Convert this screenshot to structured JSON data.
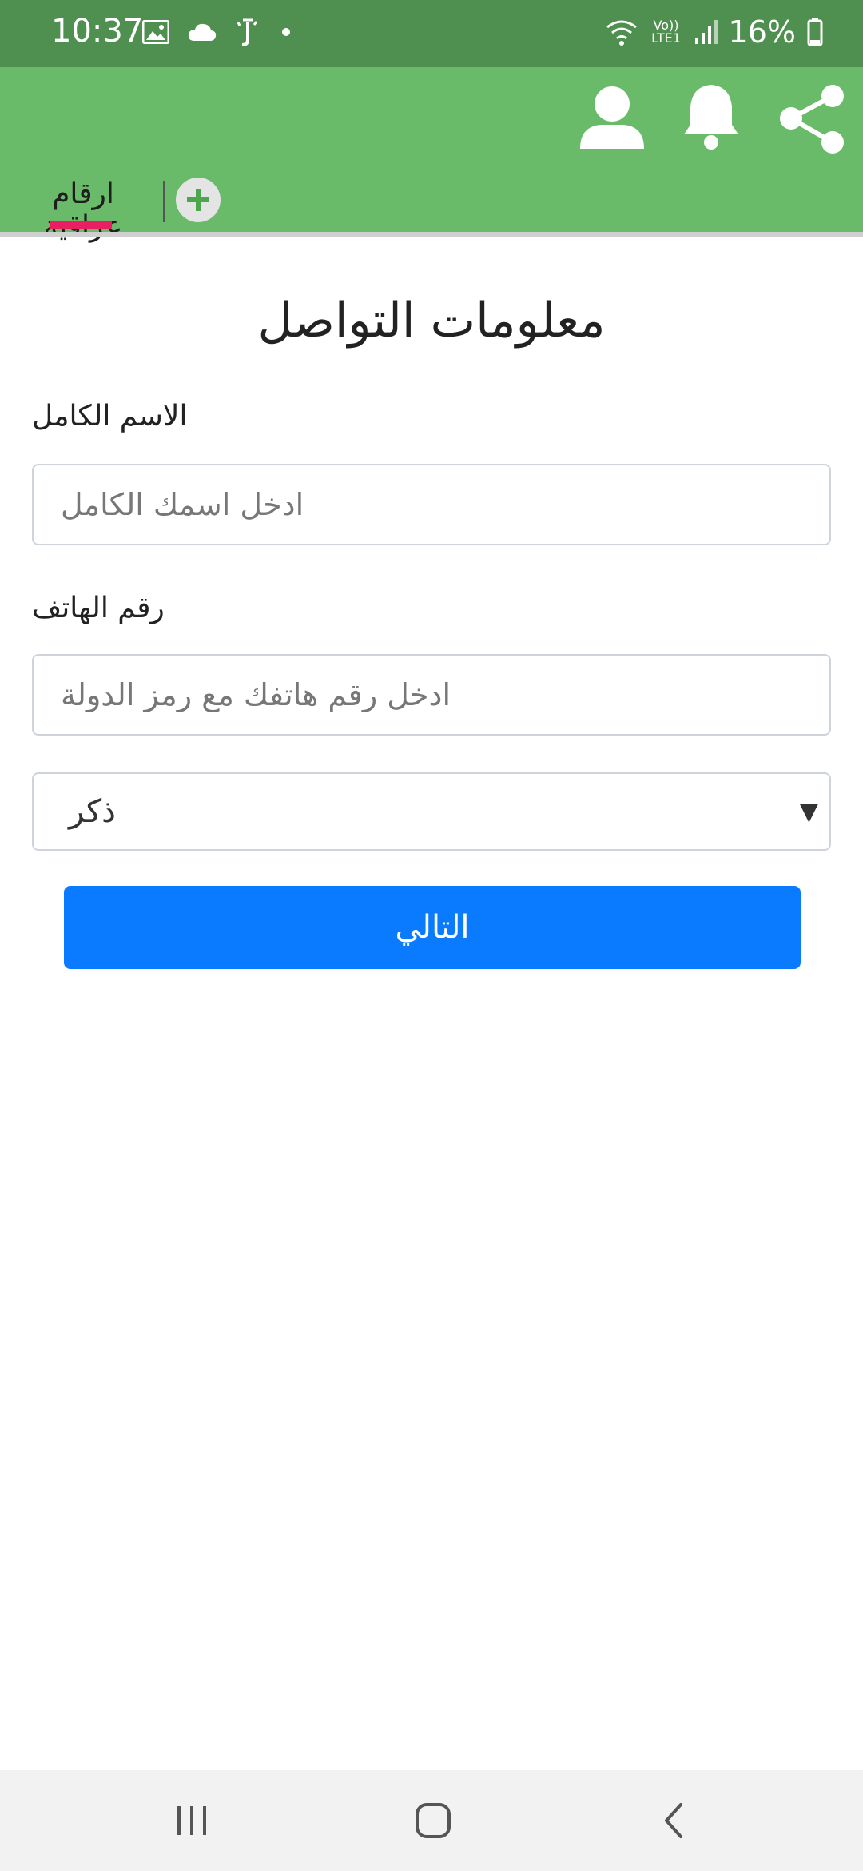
{
  "status_bar": {
    "time": "10:37",
    "battery_percent": "16%",
    "network_label": "Vo)) LTE1",
    "left_icons": [
      "gallery-icon",
      "cloud-icon",
      "notification-app-icon",
      "dot-icon"
    ],
    "right_icons": [
      "wifi-icon",
      "lte-icon",
      "signal-icon",
      "battery-icon"
    ]
  },
  "app_bar": {
    "background_color": "#69bb69",
    "actions": [
      "profile-icon",
      "bell-icon",
      "share-icon"
    ],
    "tab": {
      "label": "ارقام عراقية",
      "indicator_color": "#e91e63"
    },
    "add_tab_icon": "plus-icon"
  },
  "form": {
    "title": "معلومات التواصل",
    "name_field": {
      "label": "الاسم الكامل",
      "placeholder": "ادخل اسمك الكامل",
      "value": ""
    },
    "phone_field": {
      "label": "رقم الهاتف",
      "placeholder": "ادخل رقم هاتفك مع رمز الدولة",
      "value": ""
    },
    "gender_select": {
      "selected": "ذكر"
    },
    "next_button": {
      "label": "التالي",
      "color": "#0a7bff"
    }
  },
  "nav_bar": {
    "buttons": [
      "recent-apps-icon",
      "home-icon",
      "back-icon"
    ]
  }
}
